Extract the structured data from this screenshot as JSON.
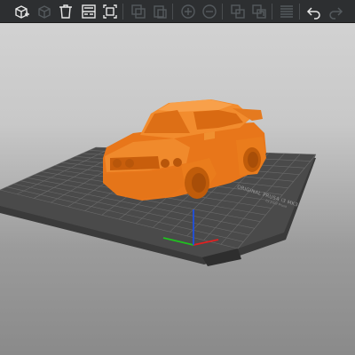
{
  "toolbar": {
    "buttons": [
      {
        "name": "add-button",
        "state": "active"
      },
      {
        "name": "delete-button",
        "state": "disabled"
      },
      {
        "name": "delete-all-button",
        "state": "active"
      },
      {
        "name": "arrange-button",
        "state": "active"
      },
      {
        "name": "arrange-selection-button",
        "state": "active"
      },
      {
        "name": "copy-button",
        "state": "disabled"
      },
      {
        "name": "paste-button",
        "state": "disabled"
      },
      {
        "name": "add-instance-button",
        "state": "disabled"
      },
      {
        "name": "remove-instance-button",
        "state": "disabled"
      },
      {
        "name": "split-objects-button",
        "state": "disabled"
      },
      {
        "name": "split-parts-button",
        "state": "disabled"
      },
      {
        "name": "layers-editing-button",
        "state": "disabled"
      },
      {
        "name": "undo-button",
        "state": "active"
      },
      {
        "name": "redo-button",
        "state": "disabled"
      }
    ]
  },
  "bed": {
    "label": "ORIGINAL PRUSA i3 MK3",
    "sublabel": "by Josef Prusa"
  },
  "colors": {
    "model": "#f07f1e",
    "bed": "#4a4a4a",
    "grid": "#6a6a6a",
    "toolbar": "#2d2f31",
    "axis_x": "#e02020",
    "axis_y": "#20c020",
    "axis_z": "#2050e0"
  }
}
